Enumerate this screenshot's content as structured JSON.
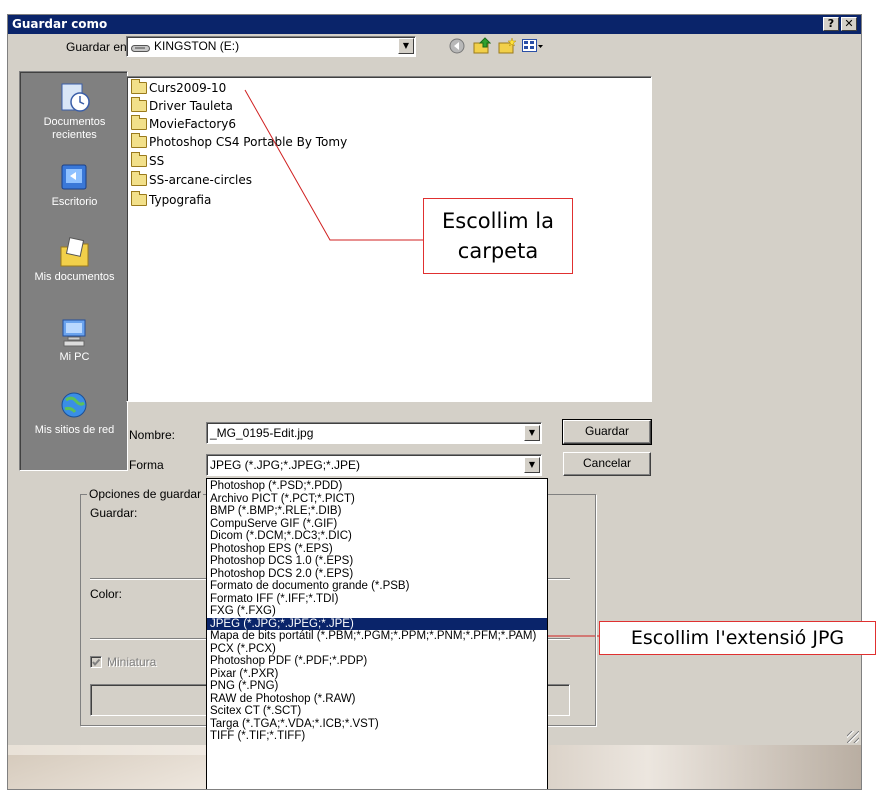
{
  "window": {
    "title": "Guardar como",
    "help_label": "?",
    "close_label": "✕"
  },
  "save_in": {
    "label": "Guardar en:",
    "value": "KINGSTON (E:)"
  },
  "places": [
    {
      "label": "Documentos recientes",
      "icon": "recent-documents-icon"
    },
    {
      "label": "Escritorio",
      "icon": "desktop-icon"
    },
    {
      "label": "Mis documentos",
      "icon": "my-documents-icon"
    },
    {
      "label": "Mi PC",
      "icon": "my-computer-icon"
    },
    {
      "label": "Mis sitios de red",
      "icon": "network-places-icon"
    }
  ],
  "folders": [
    "Curs2009-10",
    "Driver Tauleta",
    "MovieFactory6",
    "Photoshop CS4 Portable By Tomy",
    "SS",
    "SS-arcane-circles",
    "Typografia"
  ],
  "filename": {
    "label": "Nombre:",
    "value": "_MG_0195-Edit.jpg"
  },
  "format": {
    "label": "Forma",
    "value": "JPEG (*.JPG;*.JPEG;*.JPE)"
  },
  "buttons": {
    "save": "Guardar",
    "cancel": "Cancelar"
  },
  "options": {
    "title": "Opciones de guardar",
    "save_label": "Guardar:",
    "color_label": "Color:",
    "thumbnail_label": "Miniatura"
  },
  "format_options": [
    "Photoshop (*.PSD;*.PDD)",
    "Archivo PICT (*.PCT;*.PICT)",
    "BMP (*.BMP;*.RLE;*.DIB)",
    "CompuServe GIF (*.GIF)",
    "Dicom (*.DCM;*.DC3;*.DIC)",
    "Photoshop EPS (*.EPS)",
    "Photoshop DCS 1.0 (*.EPS)",
    "Photoshop DCS 2.0 (*.EPS)",
    "Formato de documento grande (*.PSB)",
    "Formato IFF (*.IFF;*.TDI)",
    "FXG (*.FXG)",
    "JPEG (*.JPG;*.JPEG;*.JPE)",
    "Mapa de bits portátil (*.PBM;*.PGM;*.PPM;*.PNM;*.PFM;*.PAM)",
    "PCX (*.PCX)",
    "Photoshop PDF (*.PDF;*.PDP)",
    "Pixar (*.PXR)",
    "PNG (*.PNG)",
    "RAW de Photoshop (*.RAW)",
    "Scitex CT (*.SCT)",
    "Targa (*.TGA;*.VDA;*.ICB;*.VST)",
    "TIFF (*.TIF;*.TIFF)"
  ],
  "selected_format_index": 11,
  "callouts": {
    "folder": "Escollim la carpeta",
    "folder_line1": "Escollim la",
    "folder_line2": "carpeta",
    "extension": "Escollim l'extensió JPG"
  },
  "colors": {
    "titlebar": "#0a246a",
    "face": "#d4d0c8",
    "callout_border": "#e03030"
  }
}
